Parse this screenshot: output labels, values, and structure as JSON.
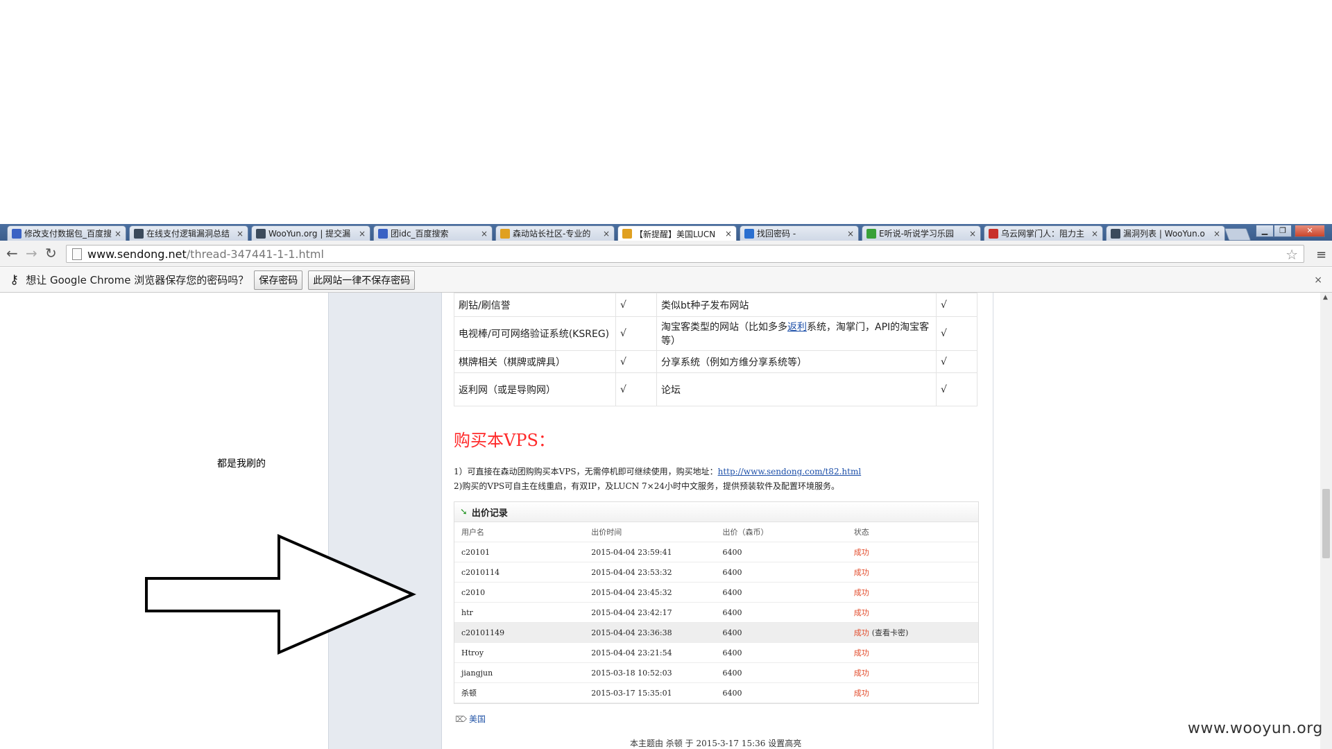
{
  "tabs": [
    {
      "title": "修改支付数据包_百度搜",
      "icon_color": "#3a62c4",
      "icon": "paw-icon"
    },
    {
      "title": "在线支付逻辑漏洞总结",
      "icon_color": "#3b4a5c",
      "icon": "wooyun-icon"
    },
    {
      "title": "WooYun.org | 提交漏",
      "icon_color": "#3b4a5c",
      "icon": "wooyun-icon"
    },
    {
      "title": "团idc_百度搜索",
      "icon_color": "#3a62c4",
      "icon": "paw-icon"
    },
    {
      "title": "森动站长社区-专业的",
      "icon_color": "#e0a020",
      "icon": "sendong-icon"
    },
    {
      "title": "【新提醒】美国LUCN",
      "icon_color": "#e0a020",
      "icon": "sendong-icon"
    },
    {
      "title": "找回密码 -",
      "icon_color": "#2a6fd0",
      "icon": "site-icon"
    },
    {
      "title": "E听说-听说学习乐园",
      "icon_color": "#38a038",
      "icon": "ear-icon"
    },
    {
      "title": "乌云网掌门人：阻力主",
      "icon_color": "#c8302a",
      "icon": "news-icon"
    },
    {
      "title": "漏洞列表 | WooYun.o",
      "icon_color": "#3b4a5c",
      "icon": "wooyun-icon"
    }
  ],
  "tab_close": "×",
  "address": {
    "host": "www.sendong.net",
    "path": "/thread-347441-1-1.html"
  },
  "infobar": {
    "text": "想让 Google Chrome 浏览器保存您的密码吗？",
    "save_label": "保存密码",
    "never_label": "此网站一律不保存密码",
    "close": "×"
  },
  "features": [
    {
      "a": "刷钻/刷信誉",
      "a_mark": "√",
      "b": "类似bt种子发布网站",
      "b_mark": "√"
    },
    {
      "a": "电视棒/可可网络验证系统(KSREG)",
      "a_mark": "√",
      "b_pre": "淘宝客类型的网站（比如多多",
      "b_link": "返利",
      "b_post": "系统，淘掌门，API的淘宝客等）",
      "b_mark": "√"
    },
    {
      "a": "棋牌相关（棋牌或牌具）",
      "a_mark": "√",
      "b": "分享系统（例如方维分享系统等）",
      "b_mark": "√"
    },
    {
      "a": "返利网（或是导购网）",
      "a_mark": "√",
      "b": "论坛",
      "b_mark": "√"
    }
  ],
  "annotation": "都是我刷的",
  "buy": {
    "title": "购买本VPS：",
    "line1": "1）可直接在森动团购购买本VPS，无需停机即可继续使用，购买地址：",
    "line1_link": "http://www.sendong.com/t82.html",
    "line2": "2)购买的VPS可自主在线重启，有双IP，及LUCN 7×24小时中文服务，提供预装软件及配置环境服务。"
  },
  "bids": {
    "title": "出价记录",
    "columns": [
      "用户名",
      "出价时间",
      "出价（森币）",
      "状态"
    ],
    "rows": [
      {
        "user": "c20101",
        "time": "2015-04-04 23:59:41",
        "price": "6400",
        "status": "成功",
        "extra": ""
      },
      {
        "user": "c2010114",
        "time": "2015-04-04 23:53:32",
        "price": "6400",
        "status": "成功",
        "extra": ""
      },
      {
        "user": "c2010",
        "time": "2015-04-04 23:45:32",
        "price": "6400",
        "status": "成功",
        "extra": ""
      },
      {
        "user": "htr",
        "time": "2015-04-04 23:42:17",
        "price": "6400",
        "status": "成功",
        "extra": ""
      },
      {
        "user": "c20101149",
        "time": "2015-04-04 23:36:38",
        "price": "6400",
        "status": "成功",
        "extra": "(查看卡密)"
      },
      {
        "user": "Htroy",
        "time": "2015-04-04 23:21:54",
        "price": "6400",
        "status": "成功",
        "extra": ""
      },
      {
        "user": "jiangjun",
        "time": "2015-03-18 10:52:03",
        "price": "6400",
        "status": "成功",
        "extra": ""
      },
      {
        "user": "杀顿",
        "time": "2015-03-17 15:35:01",
        "price": "6400",
        "status": "成功",
        "extra": ""
      }
    ]
  },
  "tag": "美国",
  "author_line": "本主题由 杀顿 于 2015-3-17 15:36 设置高亮",
  "watermark": "www.wooyun.org",
  "colors": {
    "accent_red": "#ff2a2a",
    "status_red": "#e24a2a",
    "link_blue": "#1b4ea8"
  }
}
